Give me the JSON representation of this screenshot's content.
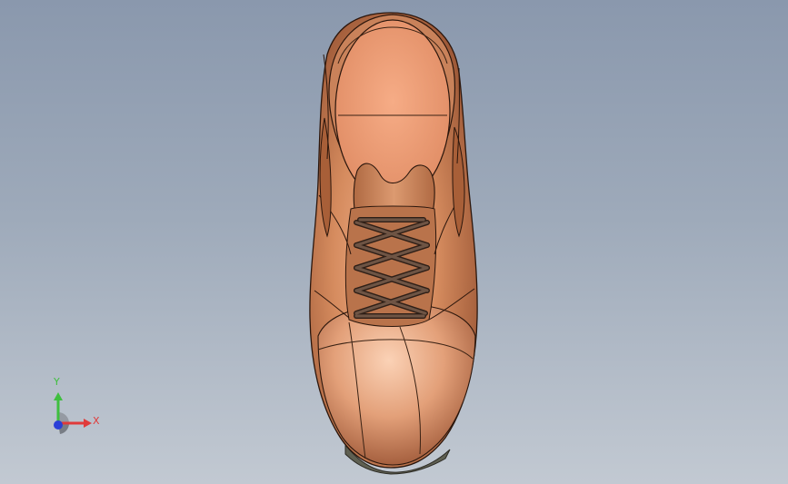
{
  "viewport": {
    "background_top": "#8a98ad",
    "background_bottom": "#c2c9d2"
  },
  "model": {
    "name": "shoe",
    "upper_color": "#c47a4f",
    "insole_color": "#f0a07a",
    "lace_color": "#5a4033",
    "sole_color": "#5f6052"
  },
  "triad": {
    "y_label": "Y",
    "x_label": "X",
    "y_color": "#3fbf3f",
    "x_color": "#e03a3a",
    "z_color": "#2a3fd8"
  }
}
